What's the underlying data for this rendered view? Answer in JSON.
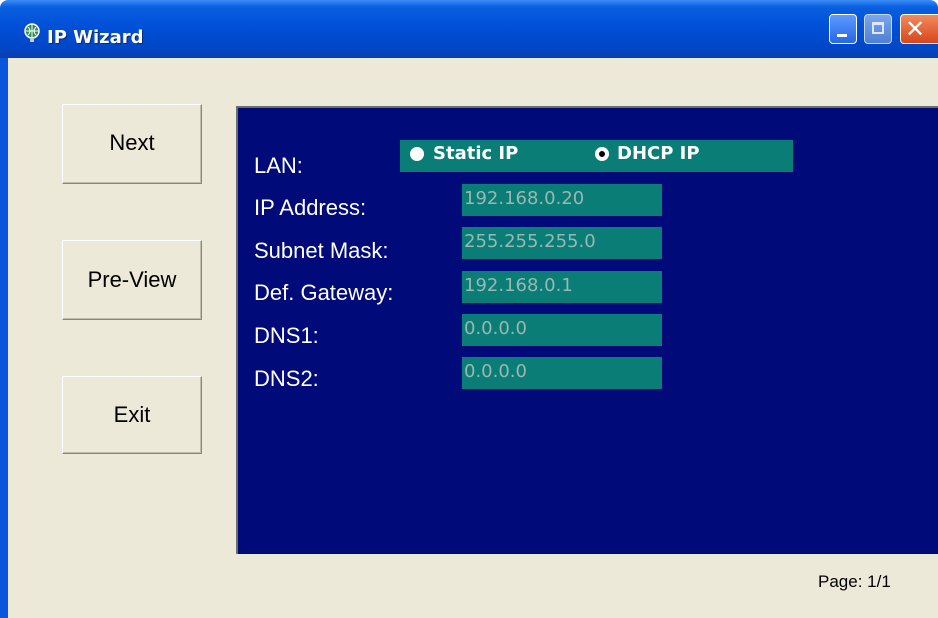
{
  "window": {
    "title": "IP Wizard",
    "icon": "ip-wizard-globe-icon",
    "controls": {
      "minimize": "minimize-icon",
      "maximize": "maximize-icon",
      "close": "close-icon",
      "close_glyph": "✕"
    }
  },
  "sidebar": {
    "next_label": "Next",
    "preview_label": "Pre-View",
    "exit_label": "Exit"
  },
  "form": {
    "lan_label": "LAN:",
    "lan_options": [
      {
        "label": "Static IP",
        "selected": false
      },
      {
        "label": "DHCP IP",
        "selected": true
      }
    ],
    "fields": [
      {
        "label": "IP Address:",
        "value": "192.168.0.20"
      },
      {
        "label": "Subnet Mask:",
        "value": "255.255.255.0"
      },
      {
        "label": "Def. Gateway:",
        "value": "192.168.0.1"
      },
      {
        "label": "DNS1:",
        "value": "0.0.0.0"
      },
      {
        "label": "DNS2:",
        "value": "0.0.0.0"
      }
    ]
  },
  "footer": {
    "page_indicator": "Page: 1/1"
  },
  "colors": {
    "panel_bg": "#000a78",
    "field_bg": "#0a7d77",
    "field_text": "#9ab7b3",
    "window_bg": "#ece9d8",
    "titlebar": "#0050d8"
  }
}
